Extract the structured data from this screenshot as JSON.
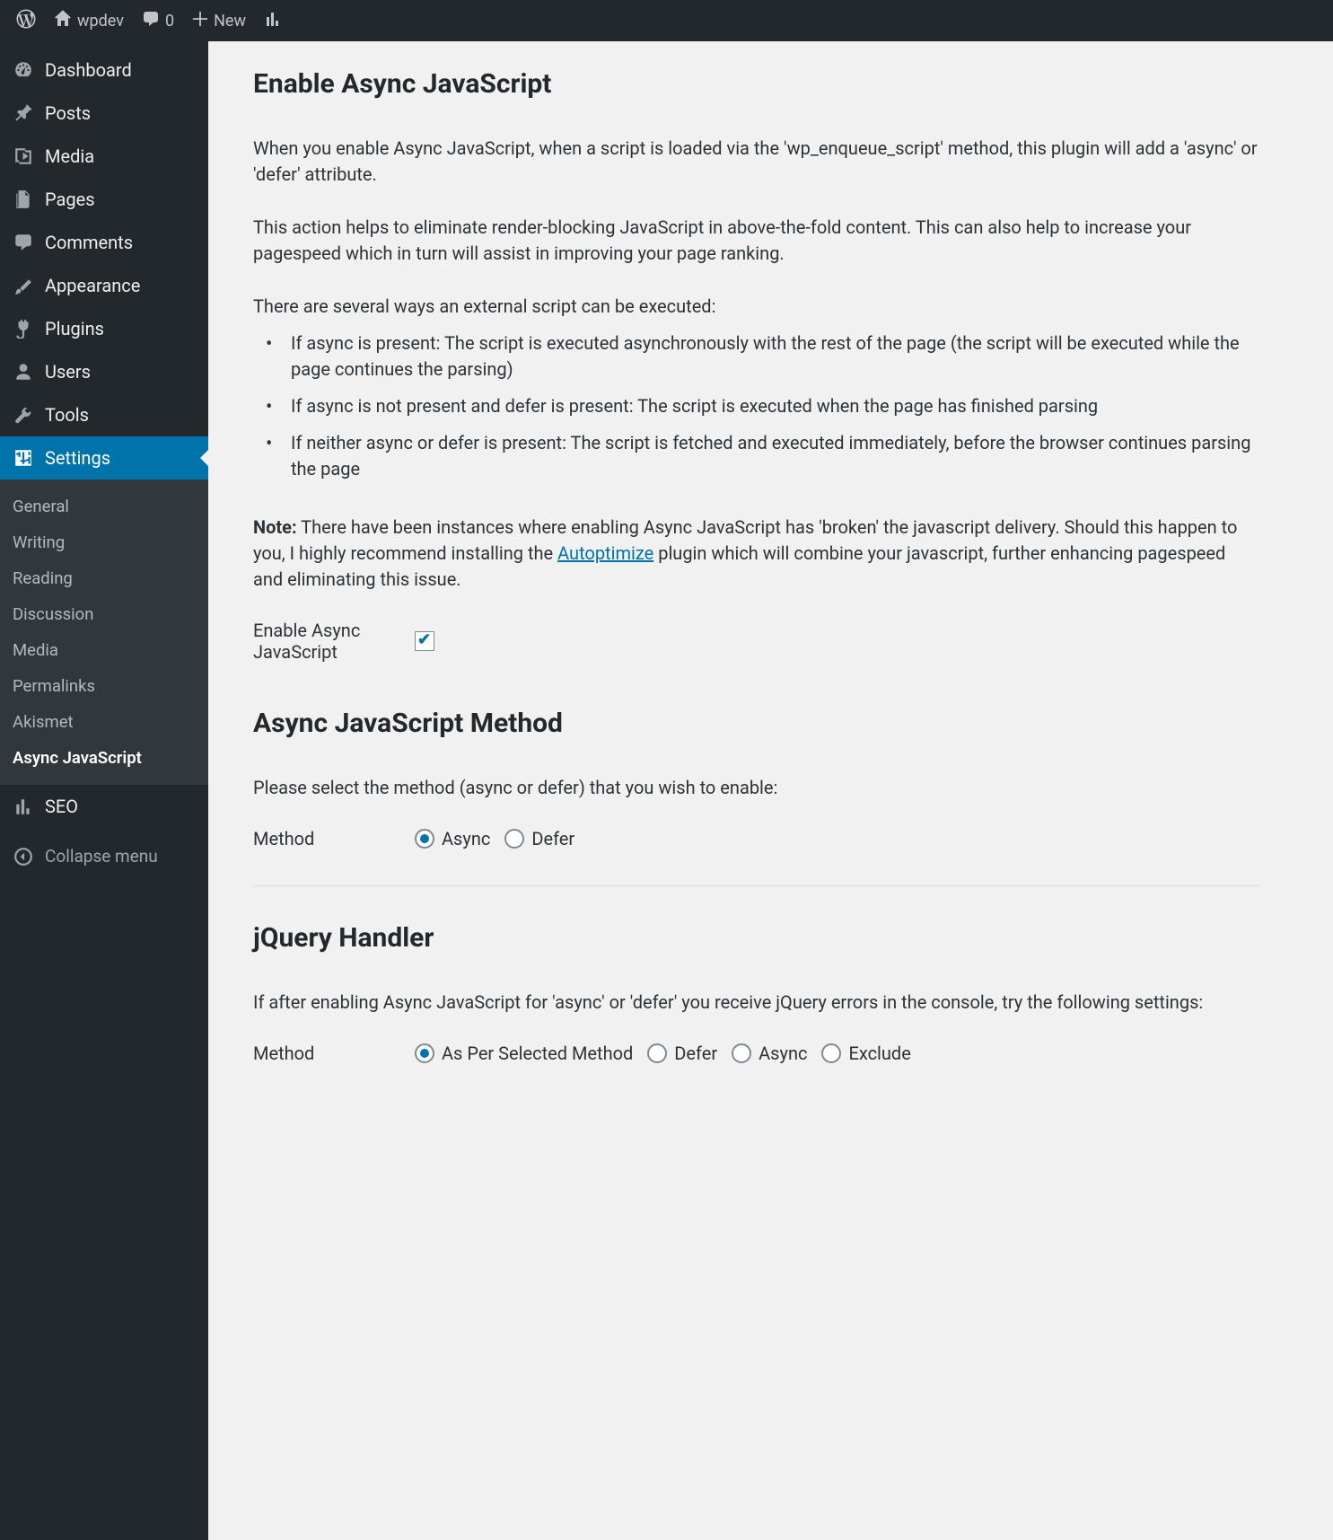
{
  "adminbar": {
    "site_name": "wpdev",
    "comments_count": "0",
    "new_label": "New"
  },
  "sidebar": {
    "items": [
      {
        "label": "Dashboard"
      },
      {
        "label": "Posts"
      },
      {
        "label": "Media"
      },
      {
        "label": "Pages"
      },
      {
        "label": "Comments"
      },
      {
        "label": "Appearance"
      },
      {
        "label": "Plugins"
      },
      {
        "label": "Users"
      },
      {
        "label": "Tools"
      },
      {
        "label": "Settings"
      }
    ],
    "settings_sub": [
      {
        "label": "General"
      },
      {
        "label": "Writing"
      },
      {
        "label": "Reading"
      },
      {
        "label": "Discussion"
      },
      {
        "label": "Media"
      },
      {
        "label": "Permalinks"
      },
      {
        "label": "Akismet"
      },
      {
        "label": "Async JavaScript"
      }
    ],
    "seo_label": "SEO",
    "collapse_label": "Collapse menu"
  },
  "main": {
    "section1": {
      "title": "Enable Async JavaScript",
      "p1": "When you enable Async JavaScript, when a script is loaded via the 'wp_enqueue_script' method, this plugin will add a 'async' or 'defer' attribute.",
      "p2": "This action helps to eliminate render-blocking JavaScript in above-the-fold content. This can also help to increase your pagespeed which in turn will assist in improving your page ranking.",
      "p3": "There are several ways an external script can be executed:",
      "li1": "If async is present: The script is executed asynchronously with the rest of the page (the script will be executed while the page continues the parsing)",
      "li2": "If async is not present and defer is present: The script is executed when the page has finished parsing",
      "li3": "If neither async or defer is present: The script is fetched and executed immediately, before the browser continues parsing the page",
      "note_label": "Note:",
      "note_before": " There have been instances where enabling Async JavaScript has 'broken' the javascript delivery. Should this happen to you, I highly recommend installing the ",
      "note_link": "Autoptimize",
      "note_after": " plugin which will combine your javascript, further enhancing pagespeed and eliminating this issue.",
      "enable_label": "Enable Async JavaScript"
    },
    "section2": {
      "title": "Async JavaScript Method",
      "p1": "Please select the method (async or defer) that you wish to enable:",
      "method_label": "Method",
      "opt_async": "Async",
      "opt_defer": "Defer"
    },
    "section3": {
      "title": "jQuery Handler",
      "p1": "If after enabling Async JavaScript for 'async' or 'defer' you receive jQuery errors in the console, try the following settings:",
      "method_label": "Method",
      "opt_selected": "As Per Selected Method",
      "opt_defer": "Defer",
      "opt_async": "Async",
      "opt_exclude": "Exclude"
    }
  }
}
